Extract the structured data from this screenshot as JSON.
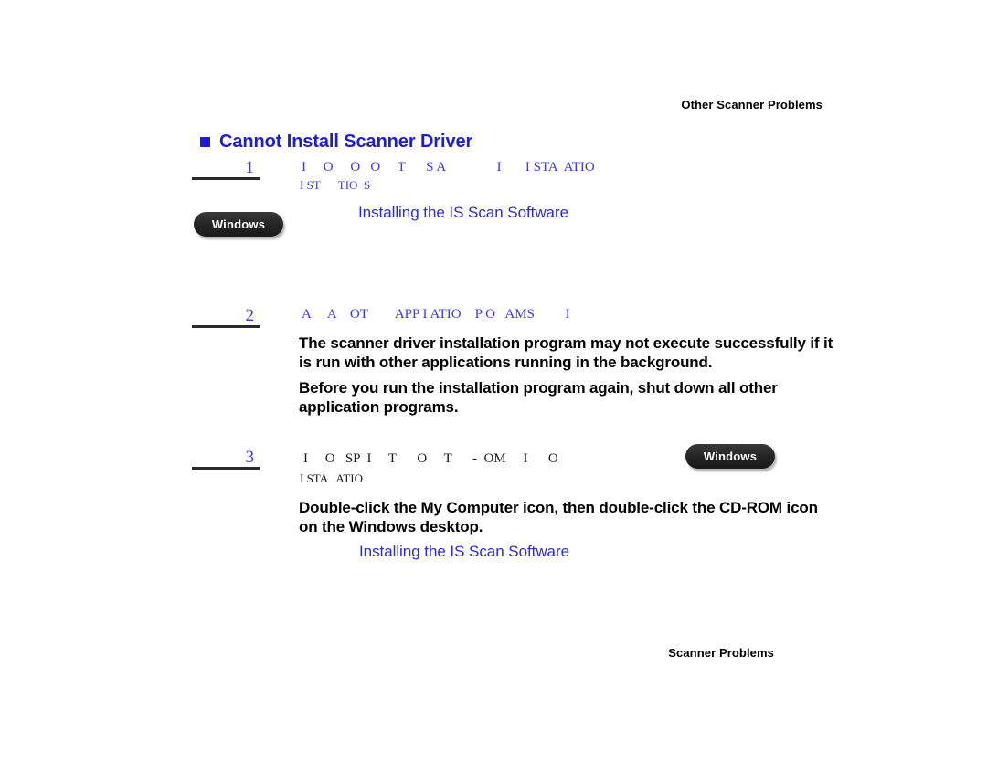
{
  "header": {
    "running_head": "Other Scanner Problems"
  },
  "footer": {
    "running_foot": "Scanner Problems"
  },
  "heading": {
    "bullet": "square-bullet",
    "title": "Cannot Install Scanner Driver"
  },
  "colors": {
    "heading_blue": "#1d1dd6",
    "link_blue": "#2b2bd8",
    "fragment_blue": "#3b3bdb",
    "rule_dark": "#2b2b2b",
    "badge_dark": "#232323",
    "body_black": "#000000"
  },
  "steps": [
    {
      "number": "1",
      "fragments_line1": "I     O     O   O     T      S A               I       I STA  ATIO",
      "fragments_line2": "I ST      TIO  S",
      "link": "Installing the IS Scan Software",
      "badge": "Windows"
    },
    {
      "number": "2",
      "fragments_line1": "A     A    OT        APP I ATIO    P O   AMS         I",
      "body1": "The scanner driver installation program may not execute successfully if it is run with other applications running in the background.",
      "body2": "Before you run the installation program again, shut down all other application programs."
    },
    {
      "number": "3",
      "fragments_line1": "I     O   SP  I     T      O     T      -  OM     I      O",
      "fragments_line2": "I STA   ATIO",
      "badge": "Windows",
      "body1": "Double-click the My Computer icon, then double-click the CD-ROM icon on the Windows desktop.",
      "link": "Installing the IS Scan Software"
    }
  ]
}
